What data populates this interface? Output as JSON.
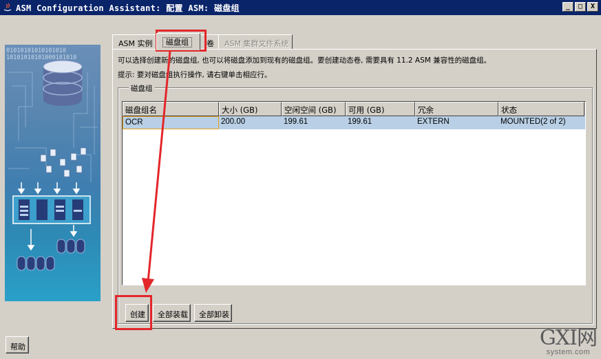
{
  "window": {
    "title": "ASM Configuration Assistant: 配置 ASM: 磁盘组",
    "minimize": "_",
    "maximize": "□",
    "close": "X"
  },
  "tabs": [
    {
      "label": "ASM 实例",
      "state": "normal"
    },
    {
      "label": "磁盘组",
      "state": "active"
    },
    {
      "label": "卷",
      "state": "partially-hidden"
    },
    {
      "label": "ASM 集群文件系统",
      "state": "disabled"
    }
  ],
  "panel": {
    "description": "可以选择创建新的磁盘组, 也可以将磁盘添加到现有的磁盘组。要创建动态卷, 需要具有 11.2 ASM 兼容性的磁盘组。",
    "hint": "提示: 要对磁盘组执行操作, 请右键单击相应行。",
    "group_label": "磁盘组"
  },
  "table": {
    "headers": [
      "磁盘组名",
      "大小 (GB)",
      "空闲空间 (GB)",
      "可用 (GB)",
      "冗余",
      "状态"
    ],
    "rows": [
      [
        "OCR",
        "200.00",
        "199.61",
        "199.61",
        "EXTERN",
        "MOUNTED(2 of 2)"
      ]
    ]
  },
  "buttons": {
    "create": "创建",
    "mount_all": "全部装载",
    "dismount_all": "全部卸装",
    "help": "帮助"
  },
  "art": {
    "binary_row1": "01010101010101010",
    "binary_row2": "10101010101000101010"
  },
  "watermark": {
    "main": "GXI网",
    "sub": "system.com"
  },
  "colors": {
    "titlebar": "#0a246a",
    "selected_row": "#b8cfe5",
    "annotation": "#e3262a"
  }
}
